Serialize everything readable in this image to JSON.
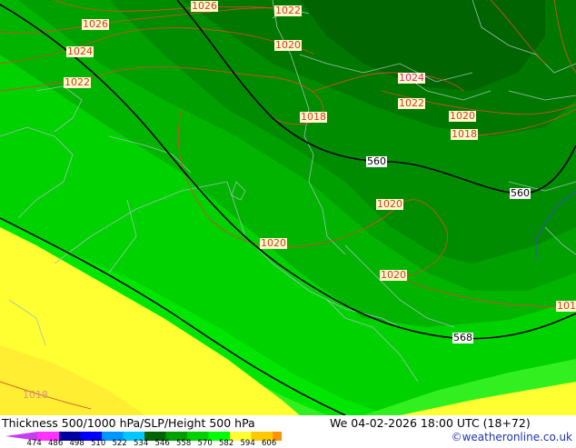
{
  "title": {
    "left": "Thickness 500/1000 hPa/SLP/Height 500 hPa",
    "right": "We 04-02-2026 18:00 UTC (18+72)",
    "credit": "©weatheronline.co.uk"
  },
  "legend": {
    "ticks": [
      "474",
      "486",
      "498",
      "510",
      "522",
      "534",
      "546",
      "558",
      "570",
      "582",
      "594",
      "606"
    ],
    "colors": [
      "#c83cf0",
      "#ff32ff",
      "#0000a0",
      "#0000ff",
      "#0096ff",
      "#00c8ff",
      "#006400",
      "#00a000",
      "#00d200",
      "#00ff00",
      "#ffff32",
      "#ffc800",
      "#ff9600"
    ]
  },
  "isobar_labels": {
    "l1026a": "1026",
    "l1026b": "1026",
    "l1022a": "1022",
    "l1024a": "1024",
    "l1020a": "1020",
    "l1022b": "1022",
    "l1024b": "1024",
    "l1018a": "1018",
    "l1022c": "1022",
    "l1020b": "1020",
    "l1018b": "1018",
    "l1020c": "1020",
    "l1020d": "1020",
    "l1020e": "1020",
    "l101": "101",
    "l1018c": "1018"
  },
  "height_labels": {
    "h560a": "560",
    "h560b": "560",
    "h568": "568"
  },
  "colors": {
    "isobar": "#c8502a",
    "height_contour": "#000000",
    "border": "#a0b4b4"
  }
}
